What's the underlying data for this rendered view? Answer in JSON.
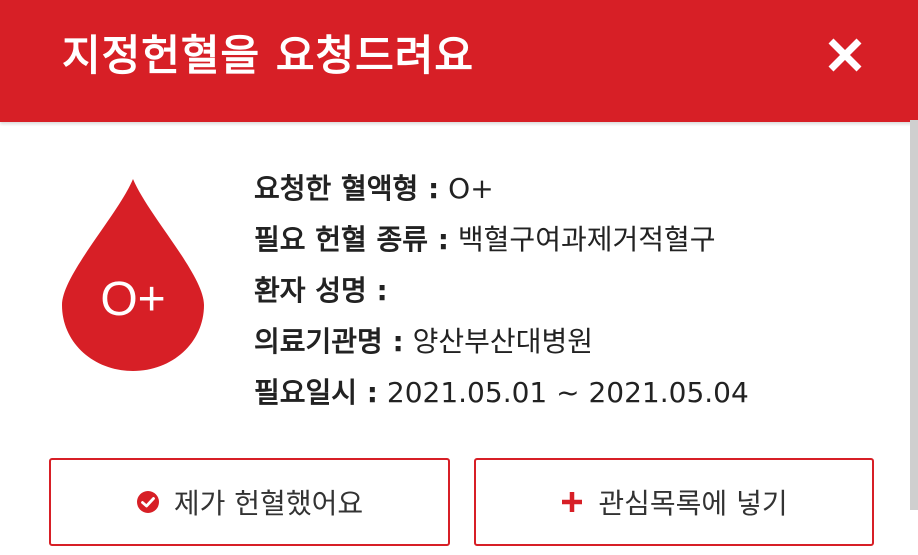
{
  "header": {
    "title": "지정헌혈을 요청드려요",
    "close_icon": "close-icon",
    "background_color": "#d71f26"
  },
  "blood_drop": {
    "icon": "blood-drop-icon",
    "label": "O+",
    "color": "#d71f26"
  },
  "details": [
    {
      "key": "요청한 혈액형 :",
      "value": " O+"
    },
    {
      "key": "필요 헌혈 종류 :",
      "value": " 백혈구여과제거적혈구"
    },
    {
      "key": "환자 성명 :",
      "value": ""
    },
    {
      "key": "의료기관명 :",
      "value": " 양산부산대병원"
    },
    {
      "key": "필요일시 :",
      "value": " 2021.05.01 ~ 2021.05.04"
    }
  ],
  "buttons": {
    "donated": {
      "label": "제가 헌혈했어요",
      "icon": "check-circle-icon"
    },
    "wishlist": {
      "label": "관심목록에 넣기",
      "icon": "plus-icon"
    }
  }
}
